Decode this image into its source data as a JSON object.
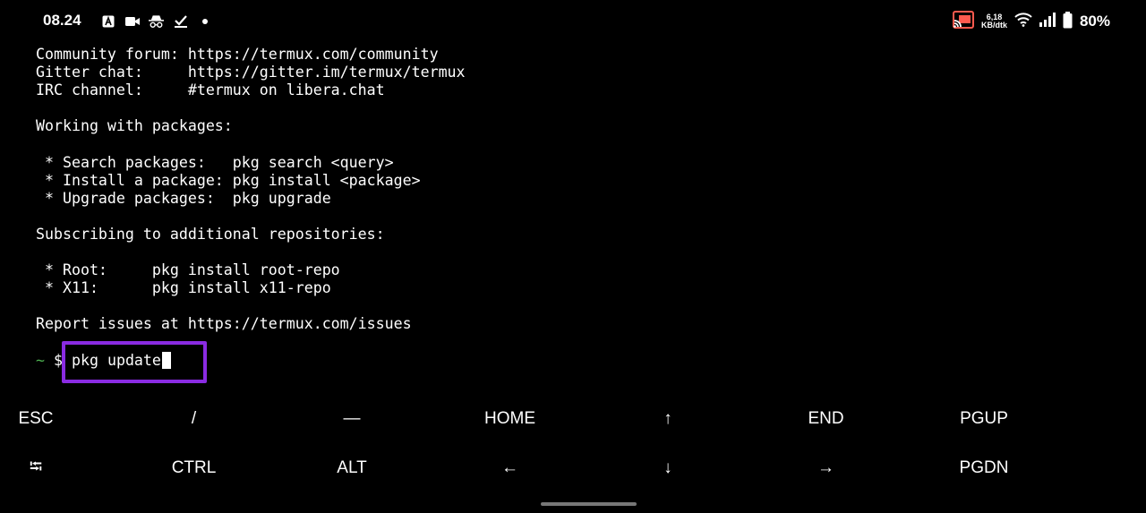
{
  "status_bar": {
    "time": "08.24",
    "left_icons": [
      "a-box-icon",
      "video-camera-icon",
      "incognito-icon",
      "check-list-icon",
      "dot-icon"
    ],
    "net_speed_value": "6,18",
    "net_speed_unit": "KB/dtk",
    "battery": "80%"
  },
  "terminal": {
    "lines": [
      "Community forum: https://termux.com/community",
      "Gitter chat:     https://gitter.im/termux/termux",
      "IRC channel:     #termux on libera.chat",
      "",
      "Working with packages:",
      "",
      " * Search packages:   pkg search <query>",
      " * Install a package: pkg install <package>",
      " * Upgrade packages:  pkg upgrade",
      "",
      "Subscribing to additional repositories:",
      "",
      " * Root:     pkg install root-repo",
      " * X11:      pkg install x11-repo",
      "",
      "Report issues at https://termux.com/issues",
      ""
    ],
    "prompt_tilde": "~",
    "prompt_symbol": "$",
    "command": "pkg update"
  },
  "extra_keys": {
    "row1": [
      "ESC",
      "/",
      "—",
      "HOME",
      "↑",
      "END",
      "PGUP"
    ],
    "row2": [
      "⭾",
      "CTRL",
      "ALT",
      "←",
      "↓",
      "→",
      "PGDN"
    ]
  },
  "colors": {
    "background": "#000000",
    "highlight_border": "#8a2be2",
    "prompt_tilde": "#4caf50"
  }
}
